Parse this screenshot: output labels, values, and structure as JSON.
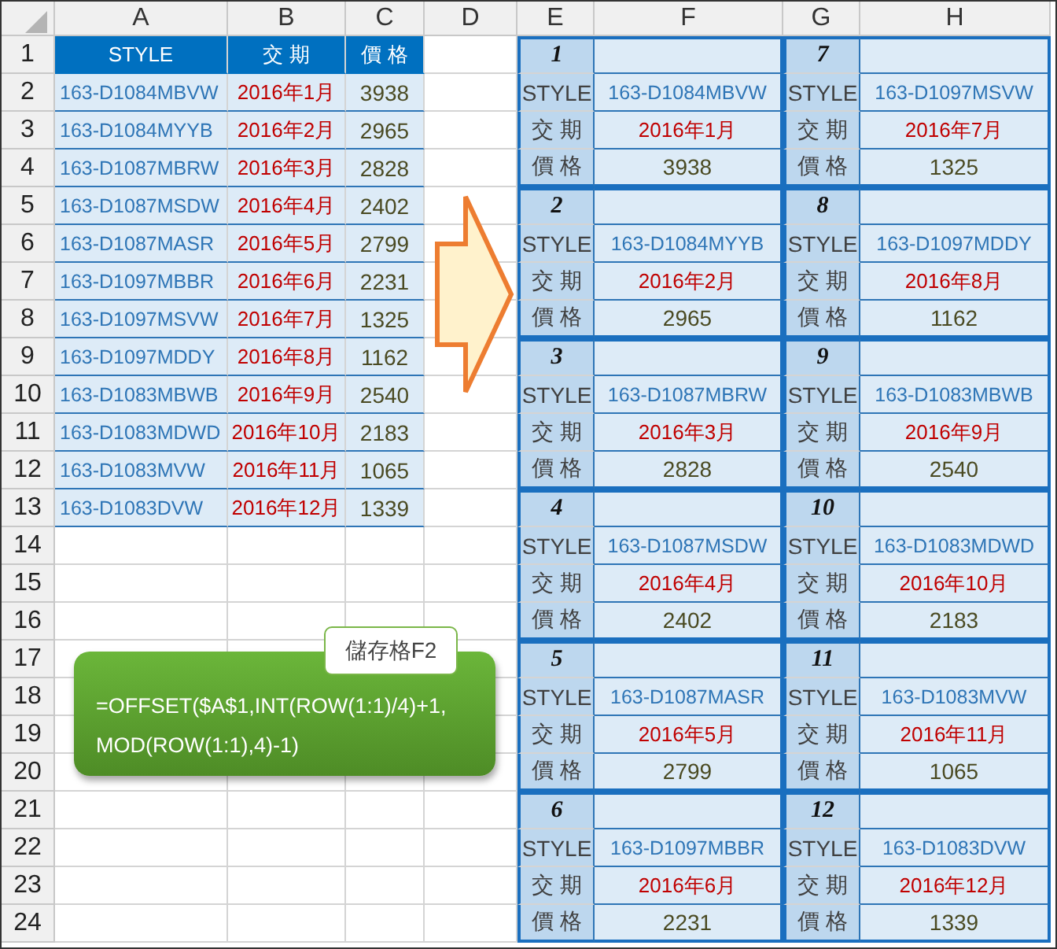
{
  "columns": [
    "A",
    "B",
    "C",
    "D",
    "E",
    "F",
    "G",
    "H"
  ],
  "row_numbers": [
    "1",
    "2",
    "3",
    "4",
    "5",
    "6",
    "7",
    "8",
    "9",
    "10",
    "11",
    "12",
    "13",
    "14",
    "15",
    "16",
    "17",
    "18",
    "19",
    "20",
    "21",
    "22",
    "23",
    "24"
  ],
  "table": {
    "headers": [
      "STYLE",
      "交 期",
      "價 格"
    ],
    "rows": [
      {
        "style": "163-D1084MBVW",
        "date": "2016年1月",
        "price": "3938"
      },
      {
        "style": "163-D1084MYYB",
        "date": "2016年2月",
        "price": "2965"
      },
      {
        "style": "163-D1087MBRW",
        "date": "2016年3月",
        "price": "2828"
      },
      {
        "style": "163-D1087MSDW",
        "date": "2016年4月",
        "price": "2402"
      },
      {
        "style": "163-D1087MASR",
        "date": "2016年5月",
        "price": "2799"
      },
      {
        "style": "163-D1097MBBR",
        "date": "2016年6月",
        "price": "2231"
      },
      {
        "style": "163-D1097MSVW",
        "date": "2016年7月",
        "price": "1325"
      },
      {
        "style": "163-D1097MDDY",
        "date": "2016年8月",
        "price": "1162"
      },
      {
        "style": "163-D1083MBWB",
        "date": "2016年9月",
        "price": "2540"
      },
      {
        "style": "163-D1083MDWD",
        "date": "2016年10月",
        "price": "2183"
      },
      {
        "style": "163-D1083MVW",
        "date": "2016年11月",
        "price": "1065"
      },
      {
        "style": "163-D1083DVW",
        "date": "2016年12月",
        "price": "1339"
      }
    ]
  },
  "cards": [
    {
      "number": "1",
      "style_label": "STYLE",
      "style": "163-D1084MBVW",
      "date_label": "交 期",
      "date": "2016年1月",
      "price_label": "價 格",
      "price": "3938"
    },
    {
      "number": "2",
      "style_label": "STYLE",
      "style": "163-D1084MYYB",
      "date_label": "交 期",
      "date": "2016年2月",
      "price_label": "價 格",
      "price": "2965"
    },
    {
      "number": "3",
      "style_label": "STYLE",
      "style": "163-D1087MBRW",
      "date_label": "交 期",
      "date": "2016年3月",
      "price_label": "價 格",
      "price": "2828"
    },
    {
      "number": "4",
      "style_label": "STYLE",
      "style": "163-D1087MSDW",
      "date_label": "交 期",
      "date": "2016年4月",
      "price_label": "價 格",
      "price": "2402"
    },
    {
      "number": "5",
      "style_label": "STYLE",
      "style": "163-D1087MASR",
      "date_label": "交 期",
      "date": "2016年5月",
      "price_label": "價 格",
      "price": "2799"
    },
    {
      "number": "6",
      "style_label": "STYLE",
      "style": "163-D1097MBBR",
      "date_label": "交 期",
      "date": "2016年6月",
      "price_label": "價 格",
      "price": "2231"
    },
    {
      "number": "7",
      "style_label": "STYLE",
      "style": "163-D1097MSVW",
      "date_label": "交 期",
      "date": "2016年7月",
      "price_label": "價 格",
      "price": "1325"
    },
    {
      "number": "8",
      "style_label": "STYLE",
      "style": "163-D1097MDDY",
      "date_label": "交 期",
      "date": "2016年8月",
      "price_label": "價 格",
      "price": "1162"
    },
    {
      "number": "9",
      "style_label": "STYLE",
      "style": "163-D1083MBWB",
      "date_label": "交 期",
      "date": "2016年9月",
      "price_label": "價 格",
      "price": "2540"
    },
    {
      "number": "10",
      "style_label": "STYLE",
      "style": "163-D1083MDWD",
      "date_label": "交 期",
      "date": "2016年10月",
      "price_label": "價 格",
      "price": "2183"
    },
    {
      "number": "11",
      "style_label": "STYLE",
      "style": "163-D1083MVW",
      "date_label": "交 期",
      "date": "2016年11月",
      "price_label": "價 格",
      "price": "1065"
    },
    {
      "number": "12",
      "style_label": "STYLE",
      "style": "163-D1083DVW",
      "date_label": "交 期",
      "date": "2016年12月",
      "price_label": "價 格",
      "price": "1339"
    }
  ],
  "callout": {
    "tag": "儲存格F2",
    "formula_lines": [
      "=OFFSET($A$1,INT(ROW(1:1)/4)+1,",
      "MOD(ROW(1:1),4)-1)"
    ]
  }
}
